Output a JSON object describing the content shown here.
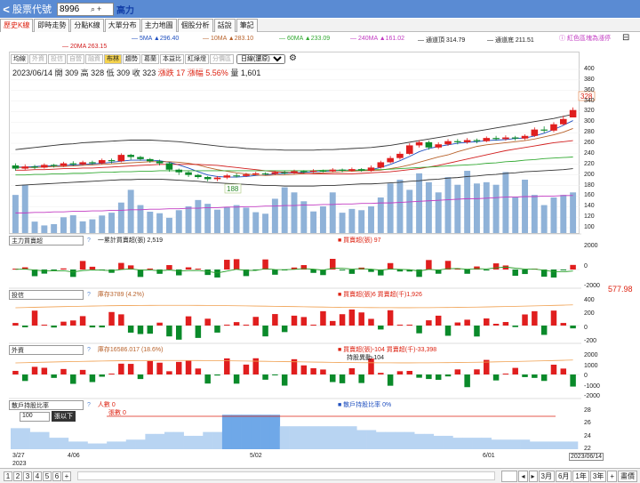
{
  "topbar": {
    "back": "<",
    "title": "股票代號",
    "stock_code": "8996",
    "search_glyph": "⌕",
    "add_glyph": "+",
    "stock_name": "高力"
  },
  "tabs": [
    "歷史K線",
    "即時走勢",
    "分點K線",
    "大單分布",
    "主力地圖",
    "個股分析",
    "話說",
    "筆記"
  ],
  "ma": [
    {
      "label": "5MA ▲296.40",
      "color": "#1f4fbf"
    },
    {
      "label": "10MA ▲283.10",
      "color": "#b8622b"
    },
    {
      "label": "60MA ▲233.09",
      "color": "#33aa33"
    },
    {
      "label": "240MA ▲161.02",
      "color": "#c23bc2"
    },
    {
      "label": "通道頂 314.79",
      "color": "#333333"
    },
    {
      "label": "通道底 211.51",
      "color": "#333333"
    }
  ],
  "ma2": {
    "label": "20MA 263.15",
    "color": "#d21f1f"
  },
  "note": "ⓘ 紅色區塊為漲停",
  "subtabs": [
    "均線",
    "外資",
    "投信",
    "自營",
    "融資",
    "布林",
    "趨勢",
    "葛蘭",
    "本益比",
    "紅綠燈",
    "分價區"
  ],
  "subtabs_active": 5,
  "range_select": "日線(還原)",
  "quote": {
    "date": "2023/06/14",
    "open": "開 309",
    "high": "高 328",
    "low": "低 309",
    "close": "收 323",
    "change": "漲跌 17",
    "pct": "漲幅 5.56%",
    "vol": "量 1,601"
  },
  "price_axis": [
    "400",
    "380",
    "360",
    "340",
    "320",
    "300",
    "280",
    "260",
    "240",
    "220",
    "200",
    "180",
    "160",
    "140",
    "120",
    "100"
  ],
  "price_labels": {
    "high": "328",
    "low": "188"
  },
  "panels": [
    {
      "select": "主力買賣超",
      "q": "?",
      "line1": "一累計買賣超(張) 2,519",
      "line2": "■ 買賣超(張) 97",
      "axis": [
        "2000",
        "0",
        "-2000"
      ],
      "side": ""
    },
    {
      "select": "投信",
      "q": "?",
      "line1": "庫存3789 (4.2%)",
      "line2": "■ 買賣超(張)6 買賣超(千)1,926",
      "axis": [
        "400",
        "200",
        "0",
        "-200"
      ],
      "side": "577.98"
    },
    {
      "select": "外資",
      "q": "?",
      "line1": "庫存16586.017 (18.6%)",
      "line2": "■ 買賣超(張)-104 買賣超(千)-33,398",
      "line3": "持股異動-104",
      "axis": [
        "2000",
        "1000",
        "0",
        "-1000",
        "-2000"
      ],
      "side": ""
    },
    {
      "select": "散戶持股比率",
      "q": "?",
      "line1": "人數 0",
      "line2": "■ 散戶持股比率 0%",
      "line3": "張數 0",
      "axis": [
        "28",
        "26",
        "24",
        "22"
      ],
      "side": "",
      "lots": "100",
      "lots_label": "張以下"
    }
  ],
  "dates": [
    "3/27",
    "4/06",
    "5/02",
    "6/01"
  ],
  "year": "2023",
  "current_date": "2023/06/14",
  "bottom": {
    "pages": [
      "1",
      "2",
      "3",
      "4",
      "5",
      "6",
      "+"
    ],
    "buttons": [
      "3月",
      "6月",
      "1年",
      "3年",
      "+",
      "畫價"
    ]
  },
  "chart_data": {
    "type": "candlestick",
    "ylim": [
      100,
      400
    ],
    "candles": [
      {
        "o": 218,
        "c": 212,
        "h": 222,
        "l": 208
      },
      {
        "o": 212,
        "c": 216,
        "h": 220,
        "l": 209
      },
      {
        "o": 216,
        "c": 214,
        "h": 219,
        "l": 211
      },
      {
        "o": 214,
        "c": 219,
        "h": 222,
        "l": 212
      },
      {
        "o": 219,
        "c": 217,
        "h": 221,
        "l": 214
      },
      {
        "o": 217,
        "c": 222,
        "h": 225,
        "l": 215
      },
      {
        "o": 222,
        "c": 220,
        "h": 226,
        "l": 217
      },
      {
        "o": 220,
        "c": 224,
        "h": 227,
        "l": 218
      },
      {
        "o": 224,
        "c": 222,
        "h": 227,
        "l": 219
      },
      {
        "o": 222,
        "c": 228,
        "h": 231,
        "l": 220
      },
      {
        "o": 228,
        "c": 226,
        "h": 231,
        "l": 222
      },
      {
        "o": 226,
        "c": 238,
        "h": 241,
        "l": 224
      },
      {
        "o": 238,
        "c": 234,
        "h": 240,
        "l": 229
      },
      {
        "o": 234,
        "c": 230,
        "h": 236,
        "l": 227
      },
      {
        "o": 230,
        "c": 226,
        "h": 232,
        "l": 223
      },
      {
        "o": 226,
        "c": 222,
        "h": 229,
        "l": 218
      },
      {
        "o": 222,
        "c": 210,
        "h": 224,
        "l": 206
      },
      {
        "o": 210,
        "c": 205,
        "h": 212,
        "l": 200
      },
      {
        "o": 205,
        "c": 200,
        "h": 207,
        "l": 196
      },
      {
        "o": 200,
        "c": 196,
        "h": 202,
        "l": 193
      },
      {
        "o": 196,
        "c": 192,
        "h": 198,
        "l": 188
      },
      {
        "o": 192,
        "c": 195,
        "h": 198,
        "l": 188
      },
      {
        "o": 195,
        "c": 199,
        "h": 202,
        "l": 192
      },
      {
        "o": 199,
        "c": 198,
        "h": 203,
        "l": 195
      },
      {
        "o": 198,
        "c": 201,
        "h": 204,
        "l": 196
      },
      {
        "o": 201,
        "c": 203,
        "h": 206,
        "l": 199
      },
      {
        "o": 203,
        "c": 202,
        "h": 205,
        "l": 200
      },
      {
        "o": 202,
        "c": 205,
        "h": 208,
        "l": 200
      },
      {
        "o": 205,
        "c": 204,
        "h": 208,
        "l": 201
      },
      {
        "o": 204,
        "c": 207,
        "h": 210,
        "l": 202
      },
      {
        "o": 207,
        "c": 206,
        "h": 209,
        "l": 203
      },
      {
        "o": 206,
        "c": 208,
        "h": 211,
        "l": 204
      },
      {
        "o": 208,
        "c": 207,
        "h": 210,
        "l": 205
      },
      {
        "o": 207,
        "c": 210,
        "h": 213,
        "l": 205
      },
      {
        "o": 210,
        "c": 208,
        "h": 212,
        "l": 205
      },
      {
        "o": 208,
        "c": 211,
        "h": 214,
        "l": 206
      },
      {
        "o": 211,
        "c": 208,
        "h": 213,
        "l": 206
      },
      {
        "o": 208,
        "c": 214,
        "h": 218,
        "l": 206
      },
      {
        "o": 214,
        "c": 224,
        "h": 227,
        "l": 212
      },
      {
        "o": 224,
        "c": 232,
        "h": 236,
        "l": 222
      },
      {
        "o": 232,
        "c": 240,
        "h": 244,
        "l": 229
      },
      {
        "o": 240,
        "c": 256,
        "h": 260,
        "l": 238
      },
      {
        "o": 256,
        "c": 262,
        "h": 266,
        "l": 252
      },
      {
        "o": 262,
        "c": 252,
        "h": 265,
        "l": 248
      },
      {
        "o": 252,
        "c": 258,
        "h": 262,
        "l": 249
      },
      {
        "o": 258,
        "c": 264,
        "h": 268,
        "l": 255
      },
      {
        "o": 264,
        "c": 262,
        "h": 268,
        "l": 258
      },
      {
        "o": 262,
        "c": 266,
        "h": 270,
        "l": 259
      },
      {
        "o": 266,
        "c": 264,
        "h": 269,
        "l": 260
      },
      {
        "o": 264,
        "c": 270,
        "h": 273,
        "l": 262
      },
      {
        "o": 270,
        "c": 268,
        "h": 274,
        "l": 265
      },
      {
        "o": 268,
        "c": 271,
        "h": 275,
        "l": 265
      },
      {
        "o": 271,
        "c": 269,
        "h": 274,
        "l": 265
      },
      {
        "o": 269,
        "c": 274,
        "h": 277,
        "l": 266
      },
      {
        "o": 274,
        "c": 286,
        "h": 290,
        "l": 272
      },
      {
        "o": 286,
        "c": 284,
        "h": 292,
        "l": 280
      },
      {
        "o": 284,
        "c": 296,
        "h": 300,
        "l": 281
      },
      {
        "o": 296,
        "c": 306,
        "h": 312,
        "l": 294
      },
      {
        "o": 309,
        "c": 323,
        "h": 328,
        "l": 309
      }
    ],
    "volume": [
      1500,
      1900,
      450,
      300,
      350,
      620,
      700,
      460,
      540,
      690,
      800,
      1200,
      1700,
      1100,
      840,
      780,
      600,
      900,
      1050,
      1300,
      1150,
      920,
      1020,
      1100,
      1000,
      820,
      760,
      1350,
      1800,
      1600,
      1250,
      850,
      1050,
      1600,
      800,
      950,
      900,
      1050,
      1400,
      1950,
      2100,
      1700,
      2350,
      2000,
      1600,
      2200,
      1900,
      2450,
      1950,
      2000,
      1900,
      2400,
      1400,
      2100,
      1500,
      1100,
      1400,
      1500,
      1600
    ],
    "ma_lines": [
      {
        "name": "5MA",
        "color": "#1f4fbf",
        "values": [
          215,
          215,
          216,
          217,
          217,
          218,
          219,
          220,
          221,
          222,
          224,
          226,
          228,
          228,
          228,
          227,
          224,
          219,
          213,
          206,
          200,
          197,
          196,
          196,
          197,
          199,
          200,
          202,
          203,
          204,
          205,
          206,
          207,
          208,
          209,
          209,
          209,
          210,
          214,
          220,
          227,
          235,
          244,
          250,
          254,
          257,
          260,
          262,
          263,
          265,
          266,
          267,
          269,
          270,
          274,
          279,
          286,
          294,
          303
        ]
      },
      {
        "name": "10MA",
        "color": "#b8622b",
        "values": [
          214,
          214,
          214,
          215,
          216,
          216,
          217,
          218,
          219,
          220,
          221,
          222,
          223,
          224,
          225,
          225,
          225,
          224,
          222,
          219,
          214,
          210,
          207,
          204,
          202,
          200,
          199,
          200,
          200,
          201,
          202,
          203,
          204,
          205,
          206,
          207,
          208,
          208,
          209,
          212,
          215,
          219,
          224,
          229,
          234,
          238,
          244,
          249,
          254,
          257,
          259,
          261,
          263,
          265,
          268,
          272,
          276,
          281,
          288
        ]
      },
      {
        "name": "20MA",
        "color": "#d21f1f",
        "values": [
          209,
          209,
          210,
          210,
          211,
          212,
          212,
          213,
          213,
          214,
          215,
          216,
          217,
          218,
          219,
          220,
          220,
          220,
          220,
          220,
          219,
          218,
          216,
          214,
          212,
          210,
          208,
          206,
          205,
          204,
          203,
          202,
          202,
          202,
          202,
          202,
          203,
          204,
          205,
          206,
          208,
          210,
          212,
          215,
          218,
          222,
          226,
          230,
          234,
          238,
          242,
          246,
          249,
          252,
          255,
          258,
          261,
          263,
          265
        ]
      },
      {
        "name": "60MA",
        "color": "#33aa33",
        "values": [
          200,
          200,
          201,
          201,
          202,
          202,
          203,
          203,
          204,
          205,
          205,
          206,
          206,
          207,
          207,
          208,
          208,
          208,
          208,
          208,
          208,
          208,
          208,
          208,
          208,
          208,
          208,
          208,
          208,
          208,
          208,
          208,
          209,
          209,
          209,
          209,
          209,
          210,
          210,
          211,
          212,
          213,
          214,
          215,
          216,
          217,
          218,
          219,
          220,
          222,
          223,
          225,
          226,
          228,
          229,
          231,
          232,
          233,
          234
        ]
      },
      {
        "name": "240MA",
        "color": "#c23bc2",
        "values": [
          128,
          128,
          129,
          129,
          130,
          130,
          131,
          131,
          132,
          132,
          133,
          133,
          134,
          134,
          135,
          135,
          136,
          136,
          137,
          137,
          138,
          138,
          139,
          139,
          140,
          140,
          141,
          141,
          142,
          142,
          143,
          143,
          144,
          144,
          145,
          145,
          146,
          146,
          147,
          147,
          148,
          149,
          150,
          151,
          152,
          153,
          154,
          155,
          155,
          156,
          157,
          158,
          158,
          159,
          159,
          160,
          160,
          161,
          161
        ]
      },
      {
        "name": "通道頂",
        "color": "#333333",
        "values": [
          248,
          250,
          252,
          254,
          256,
          258,
          259,
          261,
          262,
          263,
          264,
          265,
          266,
          266,
          266,
          265,
          264,
          263,
          261,
          259,
          257,
          255,
          253,
          252,
          250,
          249,
          248,
          248,
          247,
          247,
          247,
          247,
          248,
          248,
          249,
          250,
          251,
          252,
          254,
          256,
          259,
          262,
          265,
          268,
          271,
          274,
          277,
          280,
          283,
          286,
          289,
          292,
          295,
          298,
          301,
          304,
          307,
          311,
          315
        ]
      },
      {
        "name": "通道底",
        "color": "#333333",
        "values": [
          180,
          181,
          182,
          183,
          184,
          185,
          186,
          187,
          188,
          189,
          190,
          191,
          191,
          192,
          192,
          192,
          191,
          190,
          189,
          188,
          186,
          185,
          184,
          183,
          182,
          181,
          180,
          180,
          179,
          179,
          179,
          179,
          180,
          180,
          181,
          182,
          183,
          183,
          184,
          185,
          186,
          188,
          189,
          191,
          192,
          194,
          195,
          197,
          198,
          200,
          201,
          203,
          204,
          206,
          207,
          208,
          209,
          210,
          212
        ]
      }
    ]
  }
}
